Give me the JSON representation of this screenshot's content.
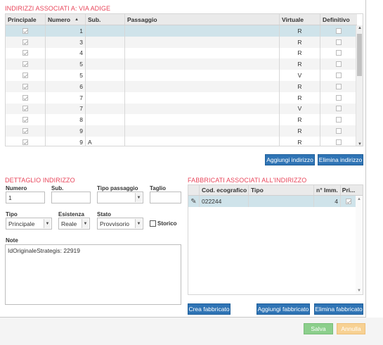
{
  "addresses": {
    "title": "INDIRIZZI ASSOCIATI A: VIA ADIGE",
    "columns": [
      "Principale",
      "Numero",
      "Sub.",
      "Passaggio",
      "Virtuale",
      "Definitivo"
    ],
    "sort_indicator": "▲",
    "rows": [
      {
        "principale": true,
        "numero": "1",
        "sub": "",
        "passaggio": "",
        "virtuale": "R",
        "definitivo": false
      },
      {
        "principale": true,
        "numero": "3",
        "sub": "",
        "passaggio": "",
        "virtuale": "R",
        "definitivo": false
      },
      {
        "principale": true,
        "numero": "4",
        "sub": "",
        "passaggio": "",
        "virtuale": "R",
        "definitivo": false
      },
      {
        "principale": true,
        "numero": "5",
        "sub": "",
        "passaggio": "",
        "virtuale": "R",
        "definitivo": false
      },
      {
        "principale": true,
        "numero": "5",
        "sub": "",
        "passaggio": "",
        "virtuale": "V",
        "definitivo": false
      },
      {
        "principale": true,
        "numero": "6",
        "sub": "",
        "passaggio": "",
        "virtuale": "R",
        "definitivo": false
      },
      {
        "principale": true,
        "numero": "7",
        "sub": "",
        "passaggio": "",
        "virtuale": "R",
        "definitivo": false
      },
      {
        "principale": true,
        "numero": "7",
        "sub": "",
        "passaggio": "",
        "virtuale": "V",
        "definitivo": false
      },
      {
        "principale": true,
        "numero": "8",
        "sub": "",
        "passaggio": "",
        "virtuale": "R",
        "definitivo": false
      },
      {
        "principale": true,
        "numero": "9",
        "sub": "",
        "passaggio": "",
        "virtuale": "R",
        "definitivo": false
      },
      {
        "principale": true,
        "numero": "9",
        "sub": "A",
        "passaggio": "",
        "virtuale": "R",
        "definitivo": false
      }
    ],
    "add_button": "Aggiungi indirizzo",
    "delete_button": "Elimina indirizzo"
  },
  "detail": {
    "title": "DETTAGLIO INDIRIZZO",
    "numero_label": "Numero",
    "numero_value": "1",
    "sub_label": "Sub.",
    "sub_value": "",
    "tipo_passaggio_label": "Tipo passaggio",
    "tipo_passaggio_value": "",
    "taglio_label": "Taglio",
    "taglio_value": "",
    "tipo_label": "Tipo",
    "tipo_value": "Principale",
    "esistenza_label": "Esistenza",
    "esistenza_value": "Reale",
    "stato_label": "Stato",
    "stato_value": "Provvisorio",
    "storico_label": "Storico",
    "note_label": "Note",
    "note_value": "IdOriginaleStrategis: 22919"
  },
  "buildings": {
    "title": "FABBRICATI ASSOCIATI ALL'INDIRIZZO",
    "columns": [
      "Cod. ecografico",
      "Tipo",
      "n° Imm.",
      "Pri..."
    ],
    "rows": [
      {
        "cod": "022244",
        "tipo": "",
        "imm": "4",
        "pri": true
      }
    ],
    "create_button": "Crea fabbricato",
    "add_button": "Aggiungi fabbricato",
    "delete_button": "Elimina fabbricato"
  },
  "footer": {
    "save_button": "Salva",
    "cancel_button": "Annulla"
  }
}
